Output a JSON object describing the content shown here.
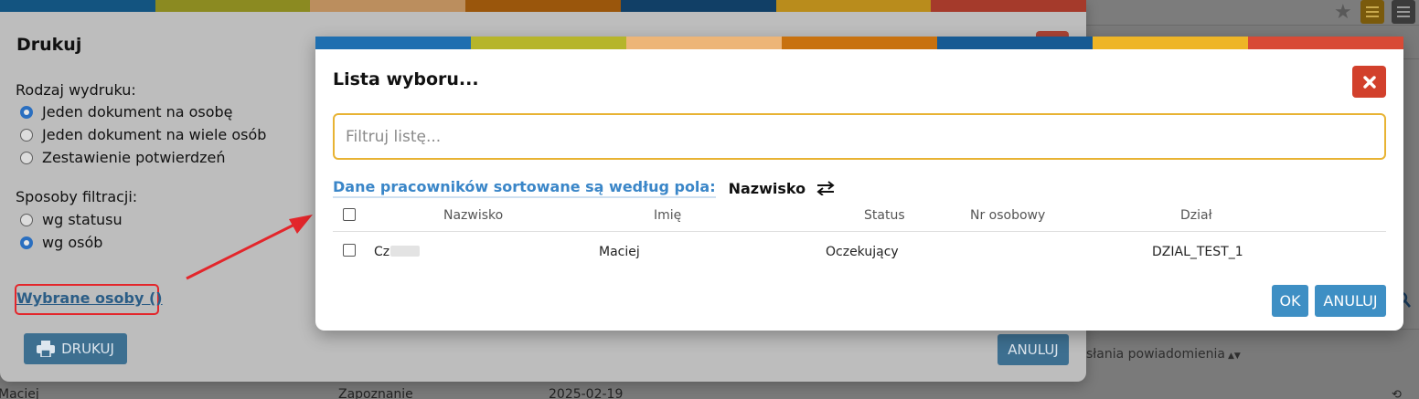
{
  "colors": {
    "stripe": [
      "#1f6fb0",
      "#b6b52a",
      "#edb577",
      "#c8710e",
      "#165a93",
      "#eeb526",
      "#d84a36"
    ],
    "stripe_dim": [
      "#135480",
      "#8b8a21",
      "#bb8e5e",
      "#9a560c",
      "#113f66",
      "#b98c1c",
      "#a53a2b"
    ],
    "accent_blue": "#3e8fc4",
    "close_red": "#d2402c",
    "filter_border": "#e8b333",
    "annotation_red": "#e3262b"
  },
  "background": {
    "column_header": "słania powiadomienia",
    "row": {
      "name": "Maciej",
      "status": "Zapoznanie",
      "date": "2025-02-19"
    },
    "icons": [
      "star-icon",
      "list-icon",
      "menu-icon",
      "search-icon",
      "history-icon"
    ]
  },
  "print_dialog": {
    "title": "Drukuj",
    "print_type_label": "Rodzaj wydruku:",
    "print_type_options": [
      {
        "label": "Jeden dokument na osobę",
        "checked": true
      },
      {
        "label": "Jeden dokument na wiele osób",
        "checked": false
      },
      {
        "label": "Zestawienie potwierdzeń",
        "checked": false
      }
    ],
    "filter_label": "Sposoby filtracji:",
    "filter_options": [
      {
        "label": "wg statusu",
        "checked": false
      },
      {
        "label": "wg osób",
        "checked": true
      }
    ],
    "selected_persons_link": "Wybrane osoby ()",
    "print_button": "DRUKUJ",
    "cancel_button": "ANULUJ"
  },
  "selection_dialog": {
    "title": "Lista wyboru...",
    "filter_placeholder": "Filtruj listę...",
    "filter_value": "",
    "sort_text": "Dane pracowników sortowane są według pola:",
    "sort_field": "Nazwisko",
    "columns": [
      "Nazwisko",
      "Imię",
      "Status",
      "Nr osobowy",
      "Dział"
    ],
    "rows": [
      {
        "surname": "Cz",
        "first_name": "Maciej",
        "status": "Oczekujący",
        "employee_no": "",
        "department": "DZIAL_TEST_1",
        "checked": false
      }
    ],
    "ok_button": "OK",
    "cancel_button": "ANULUJ"
  }
}
